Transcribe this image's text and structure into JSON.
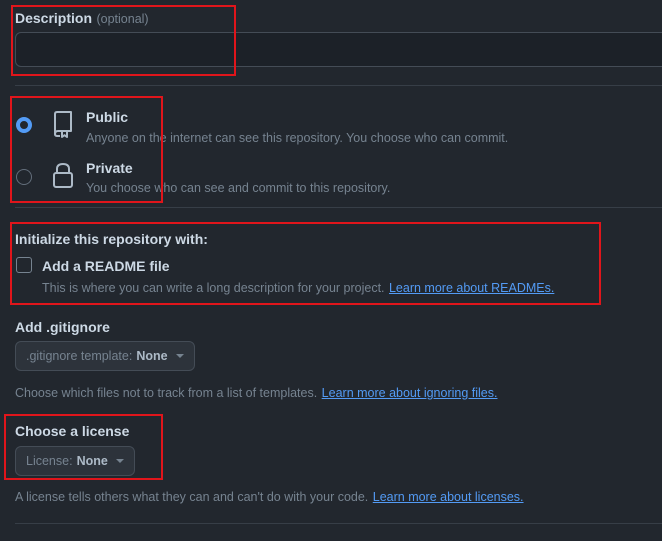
{
  "description": {
    "label": "Description",
    "optional": "(optional)",
    "value": ""
  },
  "visibility": {
    "public": {
      "title": "Public",
      "desc": "Anyone on the internet can see this repository. You choose who can commit."
    },
    "private": {
      "title": "Private",
      "desc": "You choose who can see and commit to this repository."
    },
    "selected": "public"
  },
  "initialize": {
    "heading": "Initialize this repository with:",
    "readme_label": "Add a README file",
    "readme_desc": "This is where you can write a long description for your project.",
    "readme_link": "Learn more about READMEs.",
    "readme_checked": false
  },
  "gitignore": {
    "heading": "Add .gitignore",
    "select_prefix": ".gitignore template:",
    "select_value": "None",
    "desc": "Choose which files not to track from a list of templates.",
    "link": "Learn more about ignoring files."
  },
  "license": {
    "heading": "Choose a license",
    "select_prefix": "License:",
    "select_value": "None",
    "desc": "A license tells others what they can and can't do with your code.",
    "link": "Learn more about licenses."
  },
  "colors": {
    "background": "#22272e",
    "accent": "#539bf5",
    "highlight_box": "#e0151b"
  }
}
